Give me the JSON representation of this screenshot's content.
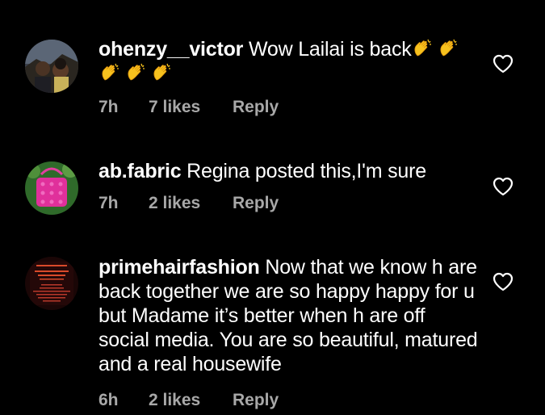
{
  "comments": [
    {
      "username": "ohenzy__victor",
      "text": "Wow Lailai is back",
      "emoji_count": 5,
      "emoji_icon": "clapping-hands-icon",
      "time": "7h",
      "likes": "7 likes",
      "reply": "Reply"
    },
    {
      "username": "ab.fabric",
      "text": "Regina posted this,I'm sure",
      "time": "7h",
      "likes": "2 likes",
      "reply": "Reply"
    },
    {
      "username": "primehairfashion",
      "text": "Now that we know h are back together we are so happy happy for u but Madame it’s better when h are off social media. You are so beautiful, matured and a real housewife",
      "time": "6h",
      "likes": "2 likes",
      "reply": "Reply"
    }
  ],
  "colors": {
    "background": "#000000",
    "primary_text": "#ffffff",
    "secondary_text": "#a8a8a8"
  },
  "icons": {
    "like": "heart-outline-icon"
  }
}
